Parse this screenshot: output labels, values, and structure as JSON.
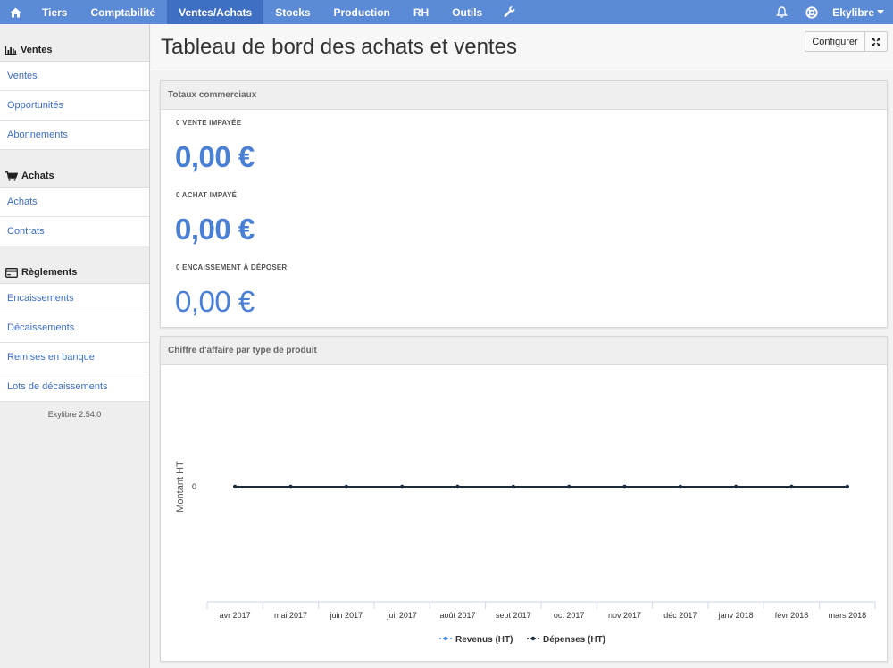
{
  "nav": {
    "items": [
      {
        "label": "Tiers"
      },
      {
        "label": "Comptabilité"
      },
      {
        "label": "Ventes/Achats"
      },
      {
        "label": "Stocks"
      },
      {
        "label": "Production"
      },
      {
        "label": "RH"
      },
      {
        "label": "Outils"
      }
    ],
    "active": "Ventes/Achats",
    "user_label": "Ekylibre",
    "nav_color": "#5b8ad6",
    "active_color": "#3f6fc2"
  },
  "sidebar": {
    "sections": [
      {
        "title": "Ventes",
        "icon": "bar-chart-icon",
        "items": [
          "Ventes",
          "Opportunités",
          "Abonnements"
        ]
      },
      {
        "title": "Achats",
        "icon": "cart-icon",
        "items": [
          "Achats",
          "Contrats"
        ]
      },
      {
        "title": "Règlements",
        "icon": "credit-card-icon",
        "items": [
          "Encaissements",
          "Décaissements",
          "Remises en banque",
          "Lots de décaissements"
        ]
      }
    ],
    "version": "Ekylibre 2.54.0"
  },
  "page": {
    "title": "Tableau de bord des achats et ventes",
    "configure_label": "Configurer"
  },
  "totaux": {
    "heading": "Totaux commerciaux",
    "kpis": [
      {
        "label": "0 vente impayée",
        "value": "0,00 €"
      },
      {
        "label": "0 achat impayé",
        "value": "0,00 €"
      },
      {
        "label": "0 encaissement à déposer",
        "value": "0,00 €"
      }
    ],
    "value_color": "#4a7fd6"
  },
  "chart_panel": {
    "heading": "Chiffre d'affaire par type de produit"
  },
  "chart_data": {
    "type": "line",
    "title": "",
    "xlabel": "",
    "ylabel": "Montant HT",
    "categories": [
      "avr 2017",
      "mai 2017",
      "juin 2017",
      "juil 2017",
      "août 2017",
      "sept 2017",
      "oct 2017",
      "nov 2017",
      "déc 2017",
      "janv 2018",
      "févr 2018",
      "mars 2018"
    ],
    "y_ticks": [
      "0"
    ],
    "series": [
      {
        "name": "Revenus (HT)",
        "color": "#4a90e2",
        "values": [
          0,
          0,
          0,
          0,
          0,
          0,
          0,
          0,
          0,
          0,
          0,
          0
        ]
      },
      {
        "name": "Dépenses (HT)",
        "color": "#1c2b3a",
        "values": [
          0,
          0,
          0,
          0,
          0,
          0,
          0,
          0,
          0,
          0,
          0,
          0
        ]
      }
    ],
    "legend": "bottom",
    "grid": false
  }
}
